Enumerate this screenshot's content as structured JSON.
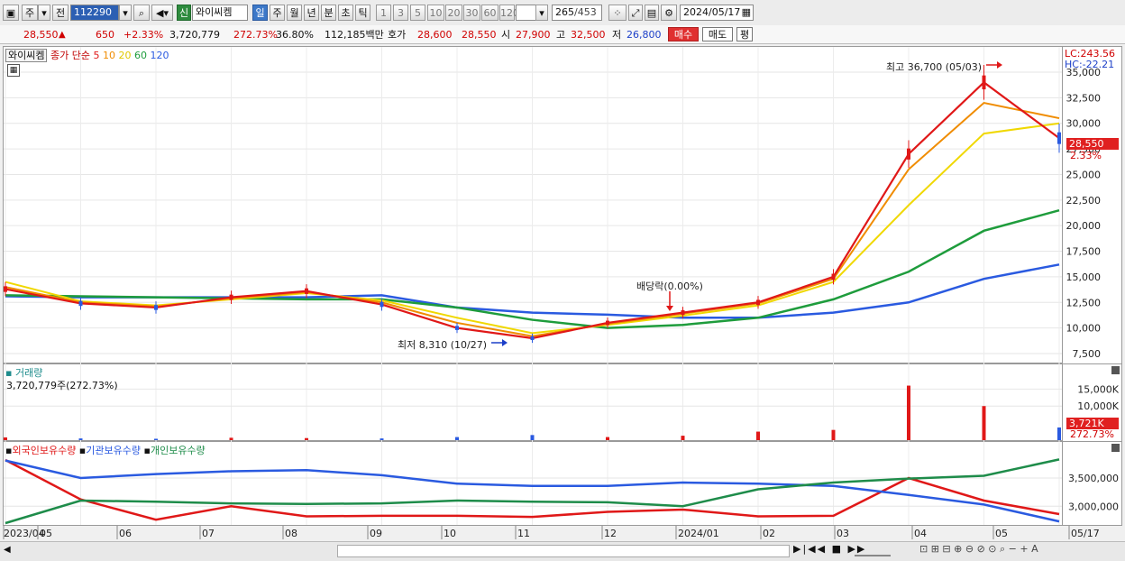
{
  "toolbar": {
    "market": "주",
    "prev": "전",
    "code": "112290",
    "badge": "신",
    "name": "와이씨켐",
    "periods": [
      "일",
      "주",
      "월",
      "년",
      "분",
      "초",
      "틱"
    ],
    "active_period": "일",
    "intervals": [
      "1",
      "3",
      "5",
      "10",
      "20",
      "30",
      "60",
      "120"
    ],
    "count": "265",
    "total": "/453",
    "date": "2024/05/17"
  },
  "quote": {
    "price": "28,550",
    "arrow": "▲",
    "change": "650",
    "pct": "+2.33%",
    "volume": "3,720,779",
    "vol_ratio": "272.73%",
    "turnover": "36.80%",
    "amount": "112,185백만",
    "hoga_label": "호가",
    "ask": "28,600",
    "bid": "28,550",
    "open_label": "시",
    "open": "27,900",
    "high_label": "고",
    "high": "32,500",
    "low_label": "저",
    "low": "26,800",
    "buy": "매수",
    "sell": "매도",
    "eval": "평"
  },
  "price_panel": {
    "legend_name": "와이씨켐",
    "legend_type": "종가 단순",
    "ma": [
      {
        "label": "5",
        "color": "#e01818"
      },
      {
        "label": "10",
        "color": "#f08c00"
      },
      {
        "label": "20",
        "color": "#f0d800"
      },
      {
        "label": "60",
        "color": "#1e9c3c"
      },
      {
        "label": "120",
        "color": "#2a5ae0"
      }
    ],
    "lc": "LC:243.56",
    "hc": "HC:-22.21",
    "high_note": "최고 36,700 (05/03)",
    "low_note": "최저 8,310 (10/27)",
    "dividend_note": "배당락(0.00%)",
    "current_tag": "28,550",
    "current_pct": "2.33%",
    "yticks": [
      "35,000",
      "32,500",
      "30,000",
      "27,500",
      "25,000",
      "22,500",
      "20,000",
      "17,500",
      "15,000",
      "12,500",
      "10,000",
      "7,500"
    ]
  },
  "volume_panel": {
    "title": "거래량",
    "value": "3,720,779주(272.73%)",
    "yticks": [
      "15,000K",
      "10,000K"
    ],
    "tag": "3,721K",
    "tag_pct": "272.73%"
  },
  "holding_panel": {
    "legend": [
      {
        "label": "외국인보유수량",
        "color": "#e01818"
      },
      {
        "label": "기관보유수량",
        "color": "#2a5ae0"
      },
      {
        "label": "개인보유수량",
        "color": "#1e8c4a"
      }
    ],
    "yticks": [
      "3,500,000",
      "3,000,000"
    ]
  },
  "xaxis": [
    "2023/04",
    "05",
    "06",
    "07",
    "08",
    "09",
    "10",
    "11",
    "12",
    "2024/01",
    "02",
    "03",
    "04",
    "05",
    "05/17"
  ],
  "chart_data": {
    "type": "line",
    "x": [
      "2023/04",
      "2023/05",
      "2023/06",
      "2023/07",
      "2023/08",
      "2023/09",
      "2023/10",
      "2023/11",
      "2023/12",
      "2024/01",
      "2024/02",
      "2024/03",
      "2024/04",
      "2024/05",
      "2024/05/17"
    ],
    "series": [
      {
        "name": "5",
        "values": [
          13800,
          12400,
          12000,
          13000,
          13600,
          12300,
          10000,
          9000,
          10500,
          11500,
          12500,
          15000,
          27000,
          34000,
          28550
        ]
      },
      {
        "name": "10",
        "values": [
          14000,
          12500,
          12100,
          12900,
          13500,
          12500,
          10500,
          9200,
          10400,
          11400,
          12400,
          14800,
          25500,
          32000,
          30500
        ]
      },
      {
        "name": "20",
        "values": [
          14500,
          12600,
          12200,
          12800,
          13400,
          12700,
          11000,
          9500,
          10300,
          11200,
          12200,
          14500,
          22000,
          29000,
          30000
        ]
      },
      {
        "name": "60",
        "values": [
          13200,
          13100,
          13000,
          12900,
          12800,
          12800,
          12000,
          10800,
          10000,
          10300,
          11000,
          12800,
          15500,
          19500,
          21500
        ]
      },
      {
        "name": "120",
        "values": [
          13100,
          13000,
          13000,
          13000,
          13000,
          13200,
          12000,
          11500,
          11300,
          11000,
          11000,
          11500,
          12500,
          14800,
          16200
        ]
      }
    ],
    "ylim": [
      7000,
      38000
    ],
    "volume_k": [
      800,
      500,
      400,
      700,
      600,
      500,
      900,
      1500,
      900,
      1300,
      2500,
      3000,
      16000,
      10000,
      3721
    ],
    "holdings": [
      {
        "name": "외국인보유수량",
        "values": [
          3820000,
          3120000,
          2760000,
          3000000,
          2820000,
          2830000,
          2830000,
          2810000,
          2900000,
          2940000,
          2820000,
          2830000,
          3500000,
          3100000,
          2860000
        ]
      },
      {
        "name": "기관보유수량",
        "values": [
          3810000,
          3500000,
          3570000,
          3620000,
          3640000,
          3550000,
          3400000,
          3360000,
          3360000,
          3420000,
          3400000,
          3360000,
          3200000,
          3030000,
          2730000
        ]
      },
      {
        "name": "개인보유수량",
        "values": [
          2700000,
          3100000,
          3080000,
          3050000,
          3040000,
          3050000,
          3100000,
          3080000,
          3070000,
          3000000,
          3300000,
          3420000,
          3490000,
          3540000,
          3830000
        ]
      }
    ],
    "holdings_ylim": [
      2700000,
      3900000
    ]
  }
}
